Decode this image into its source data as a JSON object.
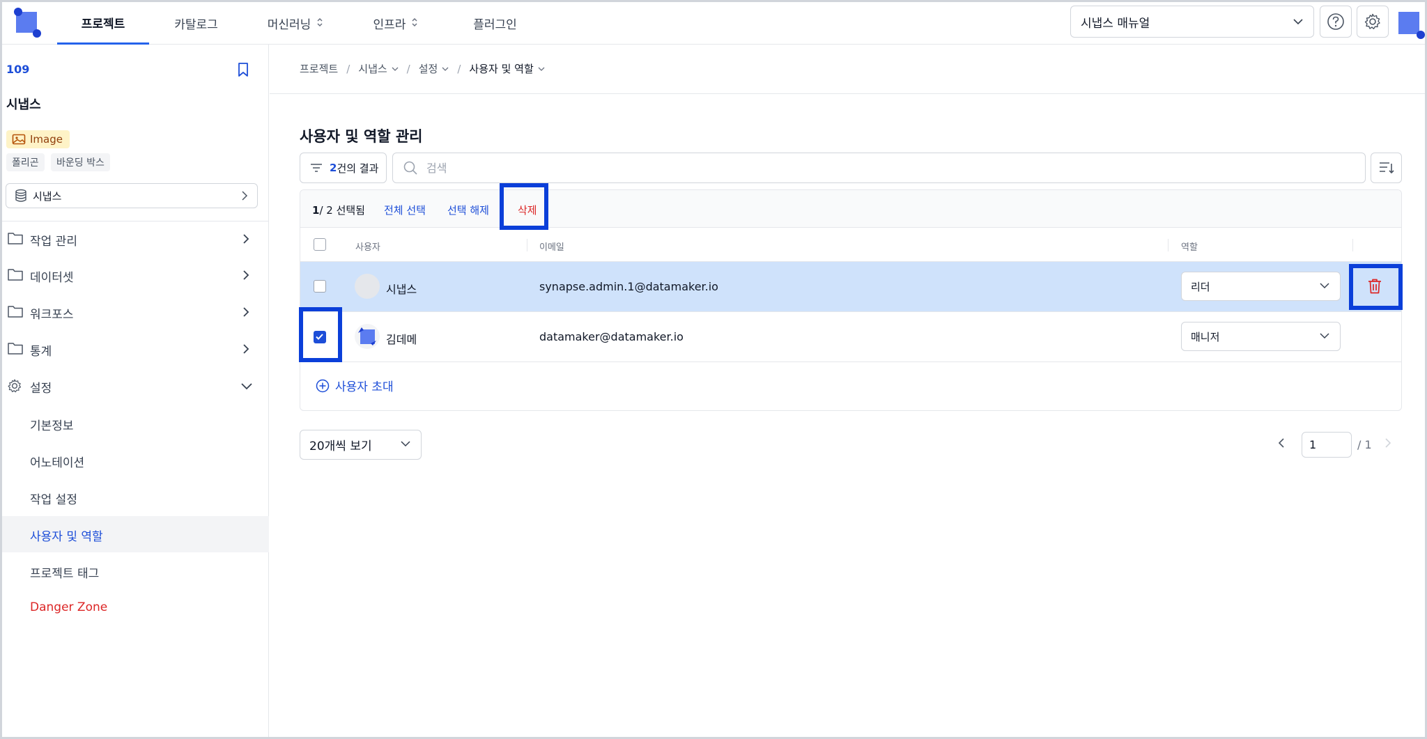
{
  "nav": {
    "tabs": [
      {
        "label": "프로젝트",
        "active": true
      },
      {
        "label": "카탈로그"
      },
      {
        "label": "머신러닝",
        "has_menu": true
      },
      {
        "label": "인프라",
        "has_menu": true
      },
      {
        "label": "플러그인"
      }
    ],
    "manual_select": "시냅스 매뉴얼",
    "help_icon": "help-circle-icon",
    "settings_icon": "gear-icon"
  },
  "sidebar": {
    "project_id": "109",
    "project_name": "시냅스",
    "type_badge": "Image",
    "tags": [
      "폴리곤",
      "바운딩 박스"
    ],
    "dataset": "시냅스",
    "menu": [
      {
        "label": "작업 관리",
        "icon": "folder-icon",
        "expanded": false
      },
      {
        "label": "데이터셋",
        "icon": "folder-icon",
        "expanded": false
      },
      {
        "label": "워크포스",
        "icon": "folder-icon",
        "expanded": false
      },
      {
        "label": "통계",
        "icon": "folder-icon",
        "expanded": false
      },
      {
        "label": "설정",
        "icon": "gear-icon",
        "expanded": true
      }
    ],
    "submenu": [
      {
        "label": "기본정보"
      },
      {
        "label": "어노테이션"
      },
      {
        "label": "작업 설정"
      },
      {
        "label": "사용자 및 역할",
        "active": true
      },
      {
        "label": "프로젝트 태그"
      },
      {
        "label": "Danger Zone",
        "danger": true
      }
    ]
  },
  "breadcrumb": [
    "프로젝트",
    "시냅스",
    "설정",
    "사용자 및 역할"
  ],
  "main": {
    "title": "사용자 및 역할 관리",
    "filter": {
      "count": "2",
      "suffix": "건의 결과"
    },
    "search_placeholder": "검색",
    "selection": {
      "selected": "1",
      "total": "/ 2 선택됨",
      "select_all": "전체 선택",
      "deselect": "선택 해제",
      "delete": "삭제"
    },
    "columns": {
      "user": "사용자",
      "email": "이메일",
      "role": "역할"
    },
    "rows": [
      {
        "name": "시냅스",
        "email": "synapse.admin.1@datamaker.io",
        "role": "리더",
        "checked": false,
        "highlighted": true
      },
      {
        "name": "김데메",
        "email": "datamaker@datamaker.io",
        "role": "매니저",
        "checked": true,
        "highlighted": false
      }
    ],
    "invite_label": "사용자 초대",
    "page_size": "20개씩 보기",
    "page_current": "1",
    "page_total": "/ 1"
  },
  "colors": {
    "accent": "#1d4ed8",
    "danger": "#dc2626",
    "highlight_row": "#cfe2fb",
    "annotation_box": "#0b3fd9"
  }
}
